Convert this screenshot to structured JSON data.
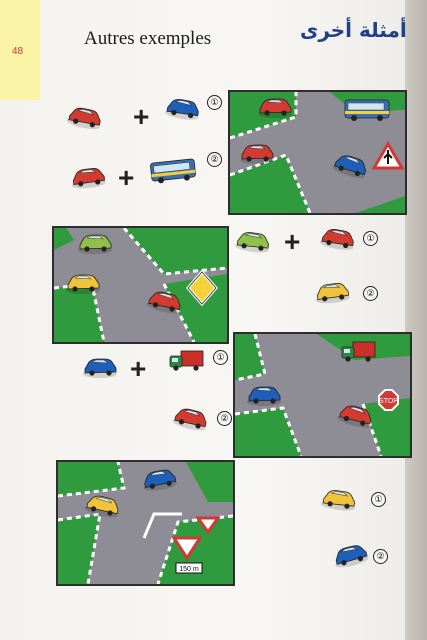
{
  "page": {
    "number": "48",
    "title_fr": "Autres exemples",
    "title_ar": "أمثلة أخرى"
  },
  "colors": {
    "yellow_tab": "#fbf4a6",
    "road": "#8e8c94",
    "grass": "#2f9b3e",
    "curb_red": "#d13a34",
    "title_ar": "#1e3f8a"
  },
  "examples": [
    {
      "marker_1": "①",
      "marker_2": "②",
      "sign": "warning-triangle-priority-right-icon"
    },
    {
      "marker_1": "①",
      "marker_2": "②",
      "sign": "priority-road-diamond-icon"
    },
    {
      "marker_1": "①",
      "marker_2": "②",
      "sign": "stop-sign-icon"
    },
    {
      "marker_1": "①",
      "marker_2": "②",
      "sign": "yield-sign-icon",
      "sign_plate": "150 m"
    }
  ],
  "plus_symbol": "+"
}
